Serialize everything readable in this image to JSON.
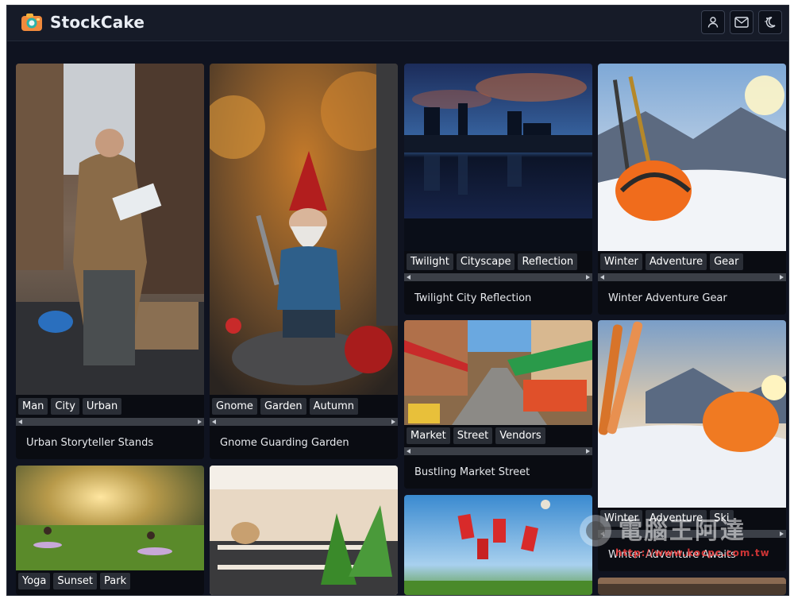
{
  "header": {
    "brand": "StockCake",
    "icons": [
      "camera-logo-icon",
      "user-icon",
      "mail-icon",
      "theme-toggle-icon"
    ]
  },
  "cards": {
    "urban": {
      "tags": [
        "Man",
        "City",
        "Urban"
      ],
      "title": "Urban Storyteller Stands"
    },
    "gnome": {
      "tags": [
        "Gnome",
        "Garden",
        "Autumn"
      ],
      "title": "Gnome Guarding Garden"
    },
    "twilight": {
      "tags": [
        "Twilight",
        "Cityscape",
        "Reflection"
      ],
      "title": "Twilight City Reflection"
    },
    "winter": {
      "tags": [
        "Winter",
        "Adventure",
        "Gear"
      ],
      "title": "Winter Adventure Gear"
    },
    "market": {
      "tags": [
        "Market",
        "Street",
        "Vendors"
      ],
      "title": "Bustling Market Street"
    },
    "ski": {
      "tags": [
        "Winter",
        "Adventure",
        "Ski"
      ],
      "title": "Winter Adventure Awaits"
    },
    "yoga": {
      "tags": [
        "Yoga",
        "Sunset",
        "Park"
      ],
      "title": ""
    }
  },
  "watermark": {
    "text": "電腦王阿達",
    "url": "http://www.kocpc.com.tw"
  }
}
